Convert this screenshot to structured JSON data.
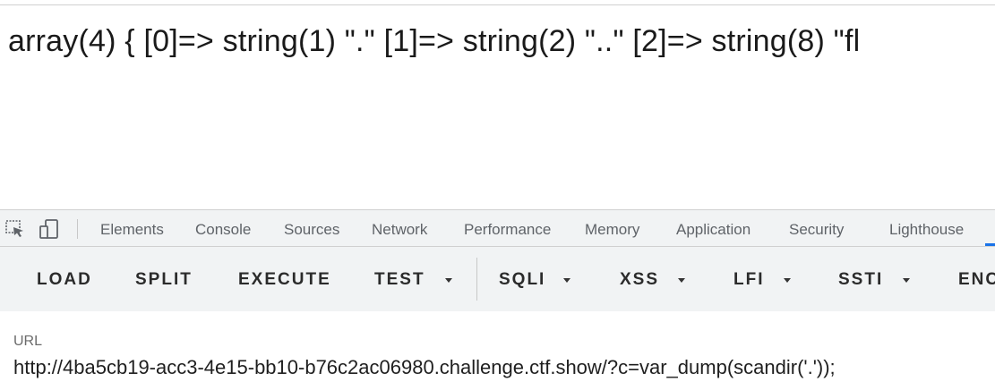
{
  "page": {
    "output_text": "array(4) { [0]=> string(1) \".\" [1]=> string(2) \"..\" [2]=> string(8) \"fl"
  },
  "devtools": {
    "icons": [
      "inspect-element-icon",
      "device-toolbar-icon"
    ],
    "tabs": [
      "Elements",
      "Console",
      "Sources",
      "Network",
      "Performance",
      "Memory",
      "Application",
      "Security",
      "Lighthouse"
    ]
  },
  "hackbar": {
    "buttons": [
      "LOAD",
      "SPLIT",
      "EXECUTE",
      "TEST",
      "SQLI",
      "XSS",
      "LFI",
      "SSTI",
      "ENC"
    ]
  },
  "url_field": {
    "label": "URL",
    "value": "http://4ba5cb19-acc3-4e15-bb10-b76c2ac06980.challenge.ctf.show/?c=var_dump(scandir('.'));"
  }
}
